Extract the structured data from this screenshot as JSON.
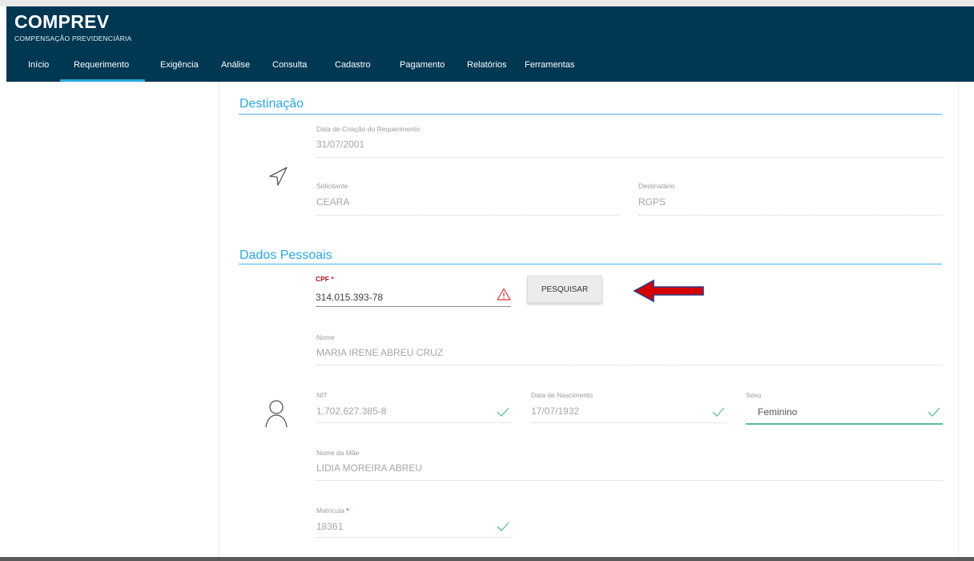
{
  "app": {
    "title": "COMPREV",
    "subtitle": "COMPENSAÇÃO PREVIDENCIÁRIA"
  },
  "nav": {
    "items": [
      {
        "label": "Início"
      },
      {
        "label": "Requerimento"
      },
      {
        "label": "Exigência"
      },
      {
        "label": "Análise"
      },
      {
        "label": "Consulta"
      },
      {
        "label": "Cadastro"
      },
      {
        "label": "Pagamento"
      },
      {
        "label": "Relatórios"
      },
      {
        "label": "Ferramentas"
      }
    ],
    "active": "Requerimento"
  },
  "destinacao": {
    "title": "Destinação",
    "data_criacao": {
      "label": "Data de Criação do Requerimento",
      "value": "31/07/2001"
    },
    "solicitante": {
      "label": "Solicitante",
      "value": "CEARA"
    },
    "destinatario": {
      "label": "Destinatário",
      "value": "RGPS"
    }
  },
  "dados_pessoais": {
    "title": "Dados Pessoais",
    "cpf": {
      "label": "CPF",
      "required_mark": "*",
      "value": "314.015.393-78"
    },
    "search_button": "PESQUISAR",
    "nome": {
      "label": "Nome",
      "value": "MARIA IRENE ABREU CRUZ"
    },
    "nit": {
      "label": "NIT",
      "value": "1.702.627.385-8"
    },
    "nascimento": {
      "label": "Data de Nascimento",
      "value": "17/07/1932"
    },
    "sexo": {
      "label": "Sexo",
      "value": "Feminino"
    },
    "nome_mae": {
      "label": "Nome da Mãe",
      "value": "LIDIA MOREIRA ABREU"
    },
    "matricula": {
      "label": "Matrícula",
      "required_mark": "*",
      "value": "18361"
    }
  },
  "colors": {
    "header_bg": "#003753",
    "accent": "#2aa8e0",
    "valid_green": "#5cbf91",
    "error_red": "#d13b3b",
    "arrow_red": "#d40000",
    "arrow_outline": "#2b3f8c"
  },
  "icons": [
    "navigation-arrow-icon",
    "user-icon",
    "warning-icon",
    "check-icon",
    "annotation-arrow"
  ]
}
